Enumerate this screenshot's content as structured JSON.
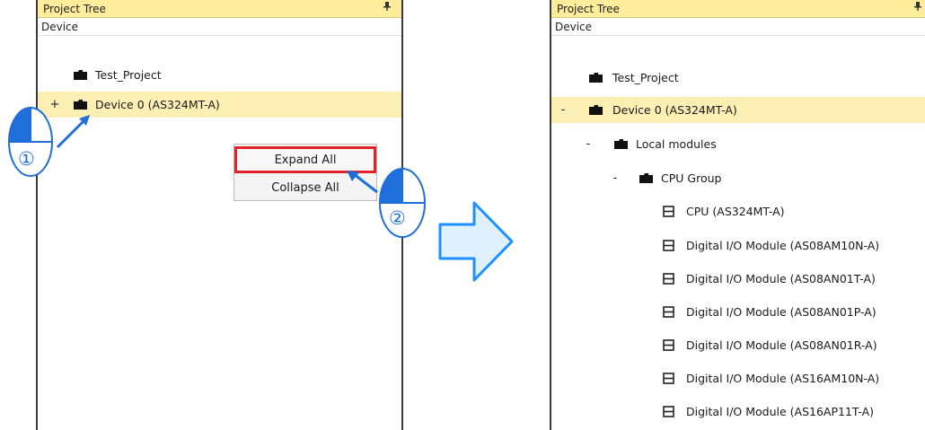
{
  "left_panel": {
    "title": "Project Tree",
    "pin_glyph": "📌",
    "header": "Device",
    "items": [
      {
        "expander": "",
        "label": "Test_Project",
        "icon": "folder-icon"
      },
      {
        "expander": "+",
        "label": "Device 0 (AS324MT-A)",
        "icon": "folder-icon"
      }
    ],
    "context_menu": {
      "expand_all": "Expand All",
      "collapse_all": "Collapse All"
    },
    "step_markers": [
      "①",
      "②"
    ]
  },
  "right_panel": {
    "title": "Project Tree",
    "pin_glyph": "📌",
    "header": "Device",
    "items": [
      {
        "expander": "",
        "label": "Test_Project",
        "icon": "folder-icon"
      },
      {
        "expander": "-",
        "label": "Device 0 (AS324MT-A)",
        "icon": "folder-icon"
      },
      {
        "expander": "-",
        "label": "Local modules",
        "icon": "folder-icon"
      },
      {
        "expander": "-",
        "label": "CPU Group",
        "icon": "folder-icon"
      },
      {
        "expander": "",
        "label": "CPU (AS324MT-A)",
        "icon": "module-icon"
      },
      {
        "expander": "",
        "label": "Digital I/O Module (AS08AM10N-A)",
        "icon": "module-icon"
      },
      {
        "expander": "",
        "label": "Digital I/O Module (AS08AN01T-A)",
        "icon": "module-icon"
      },
      {
        "expander": "",
        "label": "Digital I/O Module (AS08AN01P-A)",
        "icon": "module-icon"
      },
      {
        "expander": "",
        "label": "Digital I/O Module (AS08AN01R-A)",
        "icon": "module-icon"
      },
      {
        "expander": "",
        "label": "Digital I/O Module (AS16AM10N-A)",
        "icon": "module-icon"
      },
      {
        "expander": "",
        "label": "Digital I/O Module (AS16AP11T-A)",
        "icon": "module-icon"
      }
    ]
  },
  "colors": {
    "title_bar": "#ffed9c",
    "selected_row": "#fcefb4",
    "highlight_box": "#e3232a",
    "mouse_blue": "#1e6fd9",
    "arrow_fill": "#dff1ff",
    "arrow_stroke": "#1e90ff"
  }
}
